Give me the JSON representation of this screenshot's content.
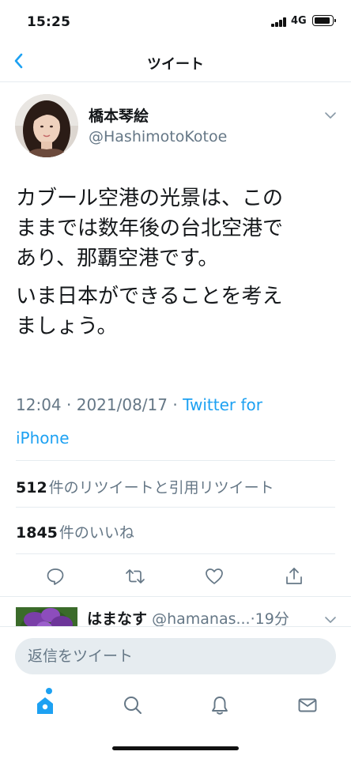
{
  "status_bar": {
    "time": "15:25",
    "network": "4G"
  },
  "nav": {
    "title": "ツイート"
  },
  "tweet": {
    "author_name": "橋本琴絵",
    "author_handle": "@HashimotoKotoe",
    "text_lines": [
      "カブール空港の光景は、この",
      "ままでは数年後の台北空港で",
      "あり、那覇空港です。"
    ],
    "text_lines_2": [
      "いま日本ができることを考え",
      "ましょう。"
    ],
    "time": "12:04",
    "separator": "·",
    "date": "2021/08/17",
    "client_prefix": "Twitter for",
    "client_suffix": "iPhone",
    "retweets_count": "512",
    "retweets_label": "件のリツイートと引用リツイート",
    "likes_count": "1845",
    "likes_label": "件のいいね"
  },
  "reply": {
    "name": "はまなす",
    "handle": "@hamanas...",
    "time": "19分"
  },
  "compose": {
    "placeholder": "返信をツイート"
  },
  "icons": {
    "back": "chevron-left-icon",
    "caret": "chevron-down-icon",
    "reply": "reply-icon",
    "retweet": "retweet-icon",
    "like": "heart-icon",
    "share": "share-icon",
    "home": "home-icon",
    "search": "search-icon",
    "notifications": "bell-icon",
    "messages": "mail-icon"
  },
  "colors": {
    "accent": "#1da1f2",
    "text": "#14171a",
    "secondary": "#657786",
    "border": "#e6ecf0"
  }
}
